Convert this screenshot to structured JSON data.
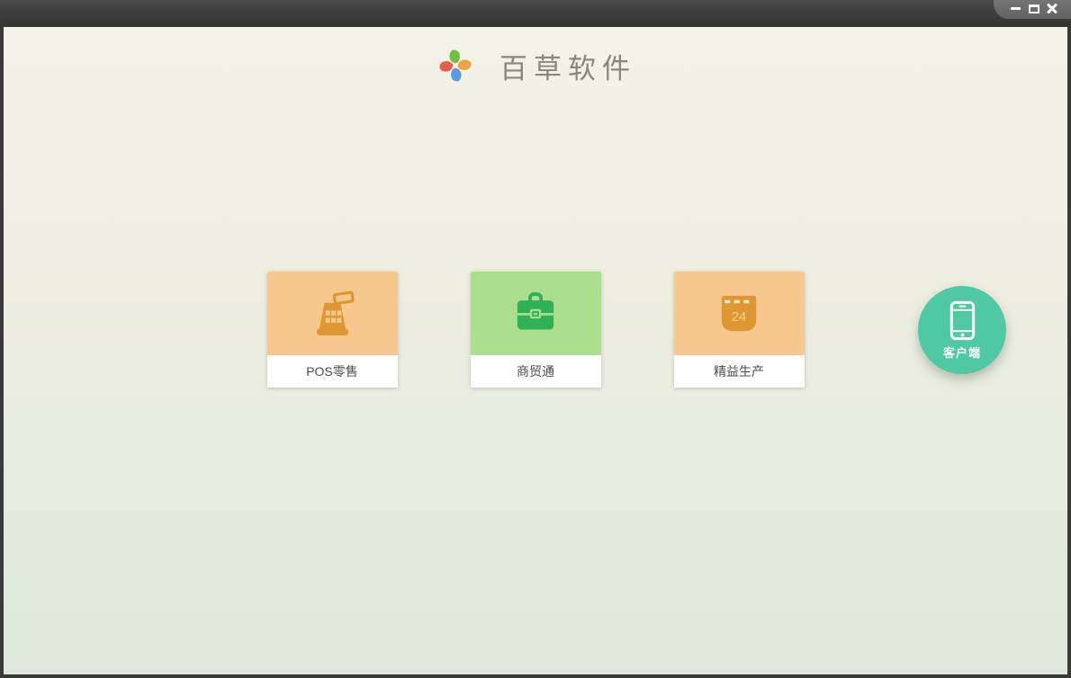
{
  "window": {
    "titlebar": {
      "controls": [
        {
          "name": "minimize"
        },
        {
          "name": "maximize"
        },
        {
          "name": "close"
        }
      ],
      "color_top": "#4a4a4a",
      "color_bottom": "#323232",
      "controls_tab_color": "#6b6b6b"
    },
    "border_color": "#3a3a38"
  },
  "header": {
    "app_title": "百草软件",
    "title_color": "#87877b",
    "logo": {
      "name": "pinwheel-logo",
      "petal_colors": [
        "#72bf44",
        "#f2a33c",
        "#5b9ce0",
        "#e2604d"
      ]
    }
  },
  "products": [
    {
      "label": "POS零售",
      "icon": "cash-register-icon",
      "tile_color": "#f6c88e",
      "icon_color": "#dd9833"
    },
    {
      "label": "商贸通",
      "icon": "briefcase-icon",
      "tile_color": "#abdf8d",
      "icon_color": "#2eb157"
    },
    {
      "label": "精益生产",
      "icon": "calendar-icon",
      "icon_text": "24",
      "tile_color": "#f6c88e",
      "icon_color": "#dd9833"
    }
  ],
  "client_button": {
    "label": "客户端",
    "icon": "smartphone-icon",
    "color": "#4ec9a2"
  },
  "theme": {
    "background_top": "#f4f2e7",
    "background_bottom": "#dee8db"
  }
}
